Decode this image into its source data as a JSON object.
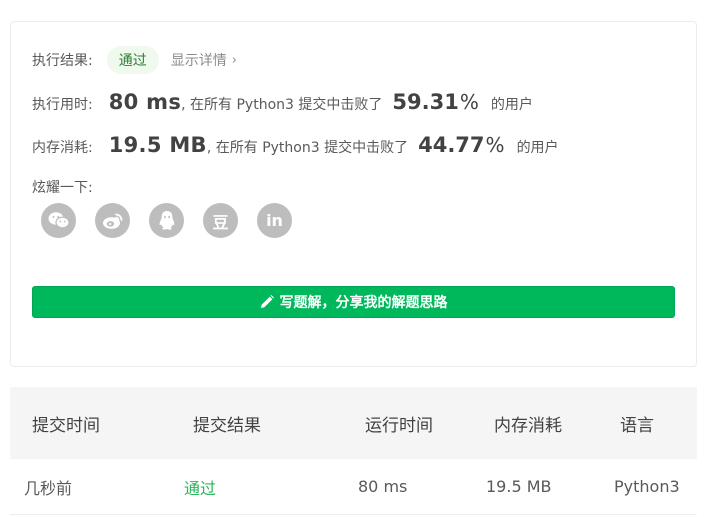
{
  "result": {
    "label": "执行结果:",
    "status": "通过",
    "details_link": "显示详情",
    "details_chevron": "›"
  },
  "runtime": {
    "label": "执行用时:",
    "value": "80 ms",
    "middle_text": ", 在所有 Python3 提交中击败了",
    "percent": "59.31",
    "percent_sign": "%",
    "suffix": "的用户"
  },
  "memory": {
    "label": "内存消耗:",
    "value": "19.5 MB",
    "middle_text": ", 在所有 Python3 提交中击败了",
    "percent": "44.77",
    "percent_sign": "%",
    "suffix": "的用户"
  },
  "share": {
    "label": "炫耀一下:",
    "icons": [
      "wechat-icon",
      "weibo-icon",
      "qq-icon",
      "douban-icon",
      "linkedin-icon"
    ],
    "douban_glyph": "豆",
    "linkedin_glyph": "in"
  },
  "write_solution_button": {
    "label": "写题解，分享我的解题思路"
  },
  "submissions": {
    "columns": [
      "提交时间",
      "提交结果",
      "运行时间",
      "内存消耗",
      "语言"
    ],
    "rows": [
      [
        "几秒前",
        "通过",
        "80 ms",
        "19.5 MB",
        "Python3"
      ]
    ]
  },
  "colors": {
    "accent_green": "#00b85c",
    "pass_text_green": "#2db55d",
    "badge_bg": "#f0f9ee",
    "icon_gray": "#bdbdbd"
  }
}
